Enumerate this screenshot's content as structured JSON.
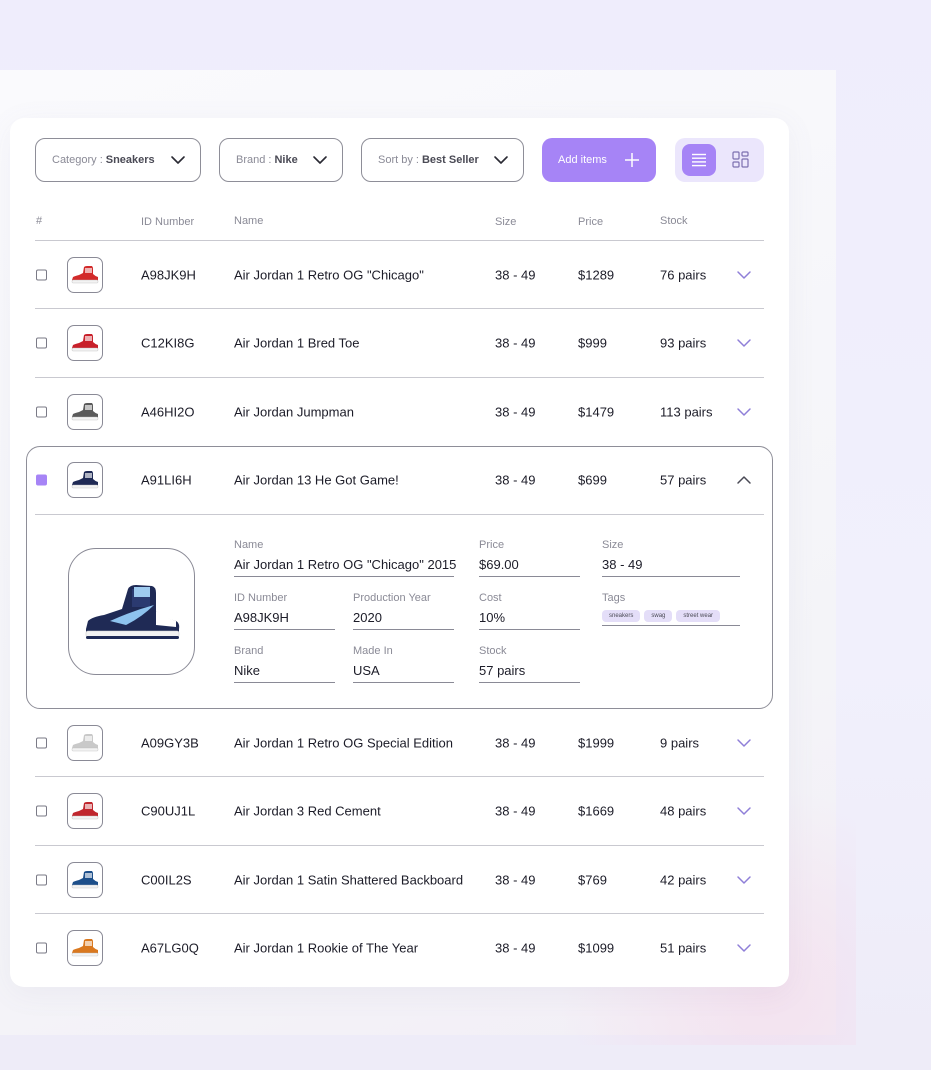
{
  "filters": {
    "category": {
      "label": "Category :",
      "value": "Sneakers"
    },
    "brand": {
      "label": "Brand :",
      "value": "Nike"
    },
    "sort": {
      "label": "Sort by :",
      "value": "Best Seller"
    }
  },
  "add_button": {
    "label": "Add items"
  },
  "view_toggle": {
    "active": "list"
  },
  "columns": {
    "index": "#",
    "id": "ID Number",
    "name": "Name",
    "size": "Size",
    "price": "Price",
    "stock": "Stock"
  },
  "colors": {
    "accent": "#a684f6",
    "accent_soft": "#ebe6fc"
  },
  "rows": [
    {
      "id": "A98JK9H",
      "name": "Air Jordan 1 Retro OG \"Chicago\"",
      "size": "38 - 49",
      "price": "$1289",
      "stock": "76 pairs",
      "checked": false,
      "color": "#d22a2a"
    },
    {
      "id": "C12KI8G",
      "name": "Air Jordan 1 Bred Toe",
      "size": "38 - 49",
      "price": "$999",
      "stock": "93 pairs",
      "checked": false,
      "color": "#c8202a"
    },
    {
      "id": "A46HI2O",
      "name": "Air Jordan Jumpman",
      "size": "38 - 49",
      "price": "$1479",
      "stock": "113 pairs",
      "checked": false,
      "color": "#5a5a5a"
    },
    {
      "id": "A91LI6H",
      "name": "Air Jordan 13 He Got Game!",
      "size": "38 - 49",
      "price": "$699",
      "stock": "57 pairs",
      "checked": true,
      "color": "#1f2a55"
    },
    {
      "id": "A09GY3B",
      "name": "Air Jordan 1 Retro OG Special Edition",
      "size": "38 - 49",
      "price": "$1999",
      "stock": "9 pairs",
      "checked": false,
      "color": "#c9c9c9"
    },
    {
      "id": "C90UJ1L",
      "name": "Air Jordan 3 Red Cement",
      "size": "38 - 49",
      "price": "$1669",
      "stock": "48 pairs",
      "checked": false,
      "color": "#c0262d"
    },
    {
      "id": "C00IL2S",
      "name": "Air Jordan 1 Satin Shattered Backboard",
      "size": "38 - 49",
      "price": "$769",
      "stock": "42 pairs",
      "checked": false,
      "color": "#1d4f8a"
    },
    {
      "id": "A67LG0Q",
      "name": "Air Jordan 1 Rookie of The Year",
      "size": "38 - 49",
      "price": "$1099",
      "stock": "51 pairs",
      "checked": false,
      "color": "#d9781f"
    }
  ],
  "detail": {
    "name": {
      "label": "Name",
      "value": "Air Jordan 1 Retro OG \"Chicago\" 2015"
    },
    "price": {
      "label": "Price",
      "value": "$69.00"
    },
    "size": {
      "label": "Size",
      "value": "38 - 49"
    },
    "id_number": {
      "label": "ID Number",
      "value": "A98JK9H"
    },
    "production_year": {
      "label": "Production Year",
      "value": "2020"
    },
    "cost": {
      "label": "Cost",
      "value": "10%"
    },
    "tags": {
      "label": "Tags",
      "items": [
        "sneakers",
        "swag",
        "street wear"
      ]
    },
    "brand": {
      "label": "Brand",
      "value": "Nike"
    },
    "made_in": {
      "label": "Made In",
      "value": "USA"
    },
    "stock": {
      "label": "Stock",
      "value": "57 pairs"
    }
  }
}
